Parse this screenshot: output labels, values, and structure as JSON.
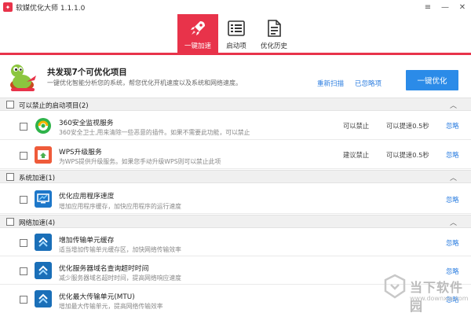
{
  "window": {
    "title": "软媒优化大师 1.1.1.0",
    "controls": [
      "≡",
      "—",
      "✕"
    ]
  },
  "tabs": [
    {
      "label": "一键加速",
      "active": true,
      "icon": "rocket-icon"
    },
    {
      "label": "启动项",
      "active": false,
      "icon": "startup-list-icon"
    },
    {
      "label": "优化历史",
      "active": false,
      "icon": "history-document-icon"
    }
  ],
  "summary": {
    "title": "共发现7个可优化项目",
    "description": "一键优化智能分析您的系统，帮您优化开机速度以及系统和网络速度。",
    "rescan_label": "重新扫描",
    "ignored_label": "已忽略项",
    "optimize_label": "一键优化"
  },
  "groups": [
    {
      "title": "可以禁止的启动项目(2)",
      "items": [
        {
          "name": "360安全监视服务",
          "desc": "360安全卫士,用来清除一些恶意的插件。如果不需要此功能，可以禁止",
          "status": "可以禁止",
          "speed": "可以提速0.5秒",
          "ignore": "忽略",
          "icon": "360-shield-icon"
        },
        {
          "name": "WPS升级服务",
          "desc": "为WPS提供升级服务。如果您手动升级WPS则可以禁止此项",
          "status": "建议禁止",
          "speed": "可以提速0.5秒",
          "ignore": "忽略",
          "icon": "wps-upgrade-icon"
        }
      ]
    },
    {
      "title": "系统加速(1)",
      "items": [
        {
          "name": "优化应用程序速度",
          "desc": "增加应用程序缓存，加快应用程序的运行速度",
          "status": "",
          "speed": "",
          "ignore": "忽略",
          "icon": "monitor-icon"
        }
      ]
    },
    {
      "title": "网络加速(4)",
      "items": [
        {
          "name": "增加传输单元缓存",
          "desc": "适当增加传输单元缓存区，加快网络传输效率",
          "status": "",
          "speed": "",
          "ignore": "忽略",
          "icon": "network-upload-icon"
        },
        {
          "name": "优化服务器域名查询超时时间",
          "desc": "减少服务器域名超时时间，提高网络响应速度",
          "status": "",
          "speed": "",
          "ignore": "忽略",
          "icon": "network-upload-icon"
        },
        {
          "name": "优化最大传输单元(MTU)",
          "desc": "增加最大传输单元，提高网络传输效率",
          "status": "",
          "speed": "",
          "ignore": "忽略",
          "icon": "network-upload-icon"
        }
      ]
    }
  ],
  "watermark": {
    "name": "当下软件园",
    "url": "www.downxia.com"
  },
  "colors": {
    "accent": "#e8334a",
    "primary_button": "#2b8be8",
    "link": "#2b7de0"
  }
}
